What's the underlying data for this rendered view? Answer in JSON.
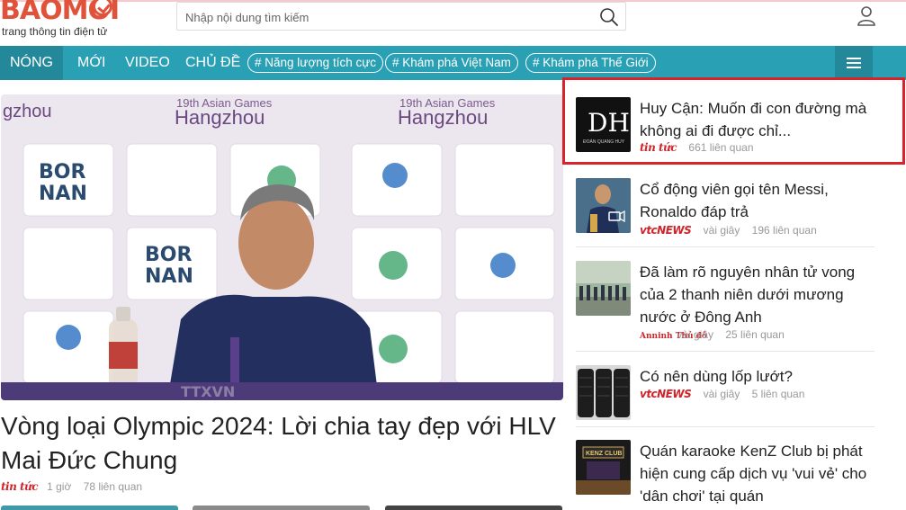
{
  "logo": {
    "word": "BAOMOI",
    "tagline": "trang thông tin điện tử"
  },
  "search": {
    "placeholder": "Nhập nội dung tìm kiếm",
    "value": ""
  },
  "nav": {
    "items": [
      "NÓNG",
      "MỚI",
      "VIDEO",
      "CHỦ ĐỀ"
    ],
    "tags": [
      "# Năng lượng tích cực",
      "# Khám phá Việt Nam",
      "# Khám phá Thế Giới"
    ]
  },
  "hero": {
    "title": "Vòng loại Olympic 2024: Lời chia tay đẹp với HLV Mai Đức Chung",
    "source": "tin tức",
    "time": "1 giờ",
    "related": "78 liên quan",
    "image_text": {
      "event": "19th Asian Games",
      "city": "Hangzhou",
      "sponsor": "BOR NAN",
      "watermark": "TTXVN"
    }
  },
  "side": [
    {
      "title": "Huy Cận: Muốn đi con đường mà không ai đi được chỉ...",
      "source": "tin tức",
      "time": "",
      "related": "661 liên quan",
      "thumb_text": "DH",
      "thumb_caption": "ĐOÀN QUANG HUY"
    },
    {
      "title": "Cổ động viên gọi tên Messi, Ronaldo đáp trả",
      "source": "vtcNEWS",
      "time": "vài giây",
      "related": "196 liên quan"
    },
    {
      "title": "Đã làm rõ nguyên nhân tử vong của 2 thanh niên dưới mương nước ở Đông Anh",
      "source": "Anninh Thủ đô",
      "time": "vài giây",
      "related": "25 liên quan"
    },
    {
      "title": "Có nên dùng lốp lướt?",
      "source": "vtcNEWS",
      "time": "vài giây",
      "related": "5 liên quan"
    },
    {
      "title": "Quán karaoke KenZ Club bị phát hiện cung cấp dịch vụ 'vui vẻ' cho 'dân chơi' tại quán",
      "source": "",
      "time": "",
      "related": "",
      "thumb_text": "KENZ CLUB"
    }
  ],
  "colors": {
    "nav": "#2aa0b4",
    "nav_active": "#23899a",
    "brand": "#e0523a",
    "highlight": "#d8232a"
  },
  "icons": [
    "search-icon",
    "user-icon",
    "hamburger-icon",
    "video-camera-icon"
  ]
}
